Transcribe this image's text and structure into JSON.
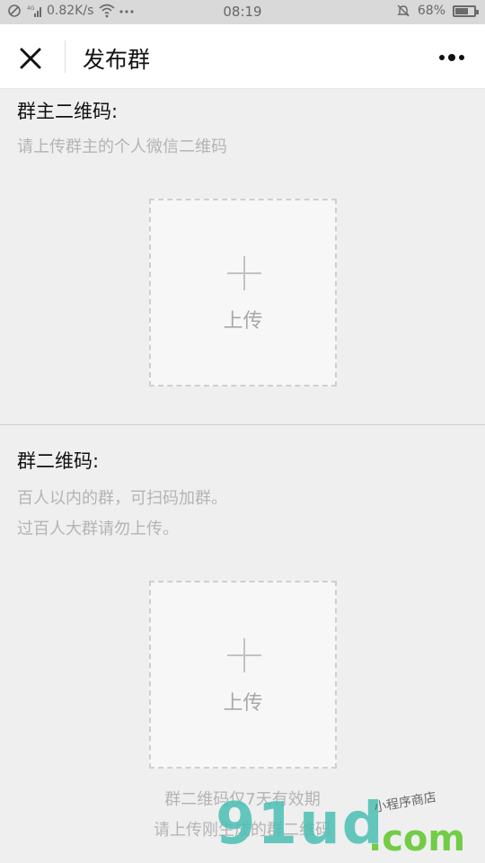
{
  "status_bar": {
    "network_speed": "0.82K/s",
    "time": "08:19",
    "battery": "68%",
    "battery_level": 0.68
  },
  "nav": {
    "title": "发布群"
  },
  "section_owner": {
    "title": "群主二维码:",
    "hint": "请上传群主的个人微信二维码",
    "upload_label": "上传"
  },
  "section_group": {
    "title": "群二维码:",
    "hint_line1": "百人以内的群，可扫码加群。",
    "hint_line2": "过百人大群请勿上传。",
    "upload_label": "上传",
    "note_line1": "群二维码仅7天有效期",
    "note_line2": "请上传刚生成的群二维码"
  },
  "watermark": {
    "main": "91ud",
    "domain": ".com",
    "tagline": "小程序商店"
  },
  "colors": {
    "background": "#efefef",
    "hint_text": "#b4b4b4",
    "dashed_border": "#cfcfcf"
  }
}
